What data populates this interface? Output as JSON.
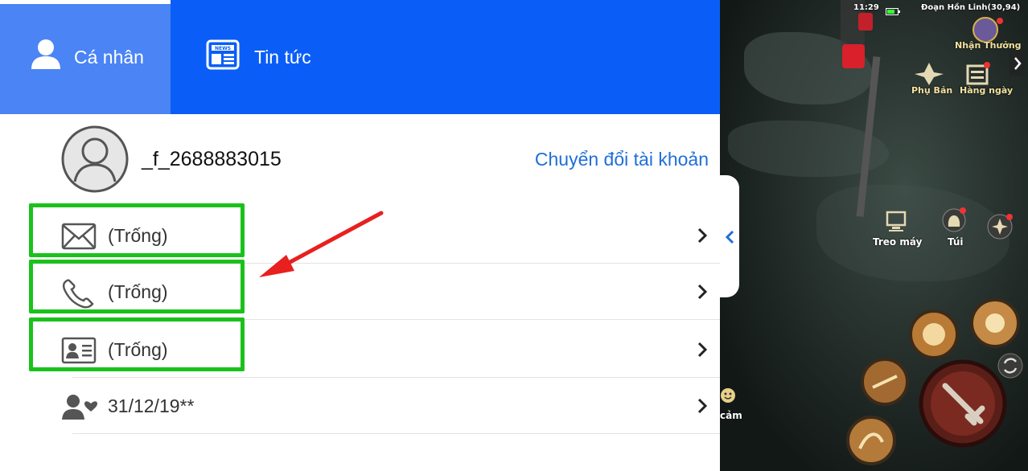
{
  "tabs": [
    {
      "label": "Cá nhân",
      "icon": "user-icon",
      "active": true
    },
    {
      "label": "Tin tức",
      "icon": "news-icon",
      "active": false
    }
  ],
  "profile": {
    "username": "_f_2688883015",
    "switch_account": "Chuyển đổi tài khoản"
  },
  "rows": [
    {
      "icon": "mail-icon",
      "value": "(Trống)"
    },
    {
      "icon": "phone-icon",
      "value": "(Trống)"
    },
    {
      "icon": "id-card-icon",
      "value": "(Trống)"
    },
    {
      "icon": "user-heart-icon",
      "value": "31/12/19**"
    }
  ],
  "game": {
    "status_time": "11:29",
    "location": "Đoạn Hồn Linh(30,94)",
    "rewards": "Nhận Thưởng",
    "dungeon": "Phụ Bản",
    "daily": "Hàng ngày",
    "idle": "Treo máy",
    "bag": "Túi",
    "emote": "cảm"
  },
  "colors": {
    "tab_bar": "#0a5ef7",
    "tab_active": "#4a84f5",
    "link": "#1f6fd8",
    "highlight": "#1bc11b",
    "arrow": "#e8201f"
  }
}
